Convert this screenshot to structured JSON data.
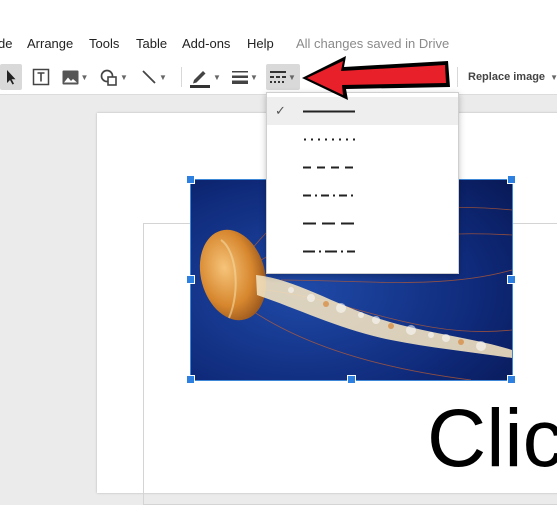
{
  "menubar": {
    "items": [
      {
        "label": "de"
      },
      {
        "label": "Arrange"
      },
      {
        "label": "Tools"
      },
      {
        "label": "Table"
      },
      {
        "label": "Add-ons"
      },
      {
        "label": "Help"
      }
    ],
    "save_status": "All changes saved in Drive"
  },
  "toolbar": {
    "tools": [
      "select-icon",
      "text-box-icon",
      "image-icon",
      "shape-icon",
      "line-icon",
      "border-color-icon",
      "border-weight-icon",
      "border-dash-icon",
      "crop-icon",
      "reset-image-icon"
    ],
    "replace_image_label": "Replace image",
    "accent_color": "#1a73e8"
  },
  "dash_menu": {
    "options": [
      {
        "style": "solid",
        "selected": true,
        "check": "✓"
      },
      {
        "style": "dotted",
        "selected": false,
        "check": ""
      },
      {
        "style": "dashed",
        "selected": false,
        "check": ""
      },
      {
        "style": "dash-dot",
        "selected": false,
        "check": ""
      },
      {
        "style": "long-dash",
        "selected": false,
        "check": ""
      },
      {
        "style": "long-dash-dot",
        "selected": false,
        "check": ""
      }
    ]
  },
  "slide": {
    "title_text": "Clic",
    "image_subject": "jellyfish photo"
  },
  "annotation": {
    "arrow_color": "#e8202a"
  }
}
